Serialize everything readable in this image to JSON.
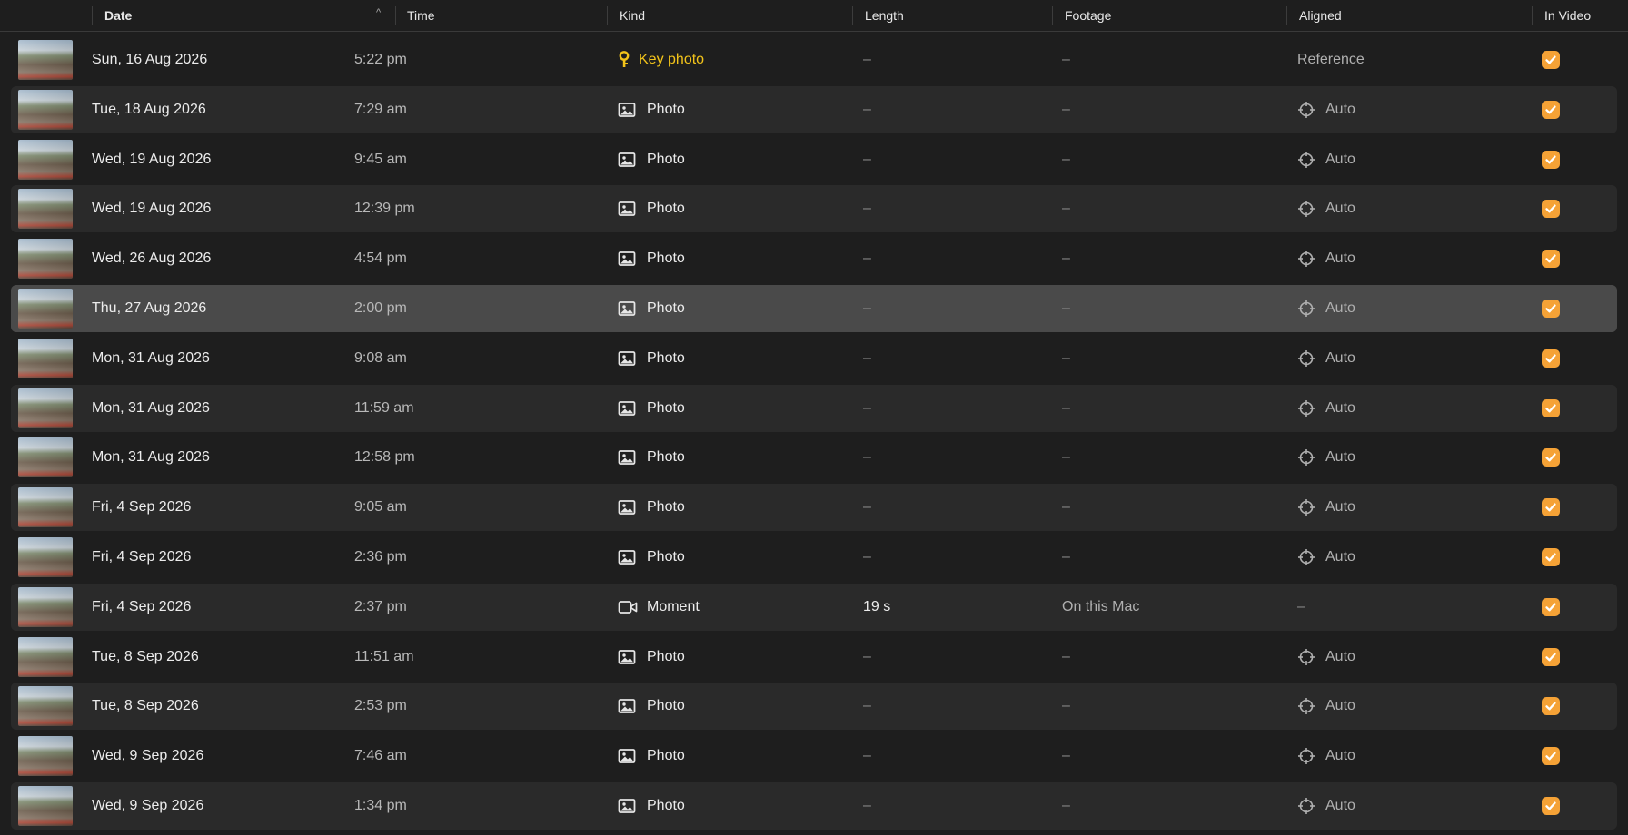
{
  "header": {
    "date": "Date",
    "time": "Time",
    "kind": "Kind",
    "length": "Length",
    "footage": "Footage",
    "aligned": "Aligned",
    "in_video": "In Video",
    "sort_indicator": "^"
  },
  "colors": {
    "accent": "#f5a236",
    "key_photo": "#f2c31a",
    "selected_row": "#4a4a4a",
    "alt_row": "#2a2a2a"
  },
  "rows": [
    {
      "date": "Sun, 16 Aug 2026",
      "time": "5:22 pm",
      "kind": "Key photo",
      "kind_icon": "key-icon",
      "length": "–",
      "footage": "–",
      "aligned": "Reference",
      "aligned_icon": "",
      "in_video": true
    },
    {
      "date": "Tue, 18 Aug 2026",
      "time": "7:29 am",
      "kind": "Photo",
      "kind_icon": "photo-icon",
      "length": "–",
      "footage": "–",
      "aligned": "Auto",
      "aligned_icon": "crosshair-icon",
      "in_video": true
    },
    {
      "date": "Wed, 19 Aug 2026",
      "time": "9:45 am",
      "kind": "Photo",
      "kind_icon": "photo-icon",
      "length": "–",
      "footage": "–",
      "aligned": "Auto",
      "aligned_icon": "crosshair-icon",
      "in_video": true
    },
    {
      "date": "Wed, 19 Aug 2026",
      "time": "12:39 pm",
      "kind": "Photo",
      "kind_icon": "photo-icon",
      "length": "–",
      "footage": "–",
      "aligned": "Auto",
      "aligned_icon": "crosshair-icon",
      "in_video": true
    },
    {
      "date": "Wed, 26 Aug 2026",
      "time": "4:54 pm",
      "kind": "Photo",
      "kind_icon": "photo-icon",
      "length": "–",
      "footage": "–",
      "aligned": "Auto",
      "aligned_icon": "crosshair-icon",
      "in_video": true
    },
    {
      "date": "Thu, 27 Aug 2026",
      "time": "2:00 pm",
      "kind": "Photo",
      "kind_icon": "photo-icon",
      "length": "–",
      "footage": "–",
      "aligned": "Auto",
      "aligned_icon": "crosshair-icon",
      "in_video": true,
      "selected": true
    },
    {
      "date": "Mon, 31 Aug 2026",
      "time": "9:08 am",
      "kind": "Photo",
      "kind_icon": "photo-icon",
      "length": "–",
      "footage": "–",
      "aligned": "Auto",
      "aligned_icon": "crosshair-icon",
      "in_video": true
    },
    {
      "date": "Mon, 31 Aug 2026",
      "time": "11:59 am",
      "kind": "Photo",
      "kind_icon": "photo-icon",
      "length": "–",
      "footage": "–",
      "aligned": "Auto",
      "aligned_icon": "crosshair-icon",
      "in_video": true
    },
    {
      "date": "Mon, 31 Aug 2026",
      "time": "12:58 pm",
      "kind": "Photo",
      "kind_icon": "photo-icon",
      "length": "–",
      "footage": "–",
      "aligned": "Auto",
      "aligned_icon": "crosshair-icon",
      "in_video": true
    },
    {
      "date": "Fri, 4 Sep 2026",
      "time": "9:05 am",
      "kind": "Photo",
      "kind_icon": "photo-icon",
      "length": "–",
      "footage": "–",
      "aligned": "Auto",
      "aligned_icon": "crosshair-icon",
      "in_video": true
    },
    {
      "date": "Fri, 4 Sep 2026",
      "time": "2:36 pm",
      "kind": "Photo",
      "kind_icon": "photo-icon",
      "length": "–",
      "footage": "–",
      "aligned": "Auto",
      "aligned_icon": "crosshair-icon",
      "in_video": true
    },
    {
      "date": "Fri, 4 Sep 2026",
      "time": "2:37 pm",
      "kind": "Moment",
      "kind_icon": "video-icon",
      "length": "19 s",
      "footage": "On this Mac",
      "aligned": "–",
      "aligned_icon": "",
      "in_video": true
    },
    {
      "date": "Tue, 8 Sep 2026",
      "time": "11:51 am",
      "kind": "Photo",
      "kind_icon": "photo-icon",
      "length": "–",
      "footage": "–",
      "aligned": "Auto",
      "aligned_icon": "crosshair-icon",
      "in_video": true
    },
    {
      "date": "Tue, 8 Sep 2026",
      "time": "2:53 pm",
      "kind": "Photo",
      "kind_icon": "photo-icon",
      "length": "–",
      "footage": "–",
      "aligned": "Auto",
      "aligned_icon": "crosshair-icon",
      "in_video": true
    },
    {
      "date": "Wed, 9 Sep 2026",
      "time": "7:46 am",
      "kind": "Photo",
      "kind_icon": "photo-icon",
      "length": "–",
      "footage": "–",
      "aligned": "Auto",
      "aligned_icon": "crosshair-icon",
      "in_video": true
    },
    {
      "date": "Wed, 9 Sep 2026",
      "time": "1:34 pm",
      "kind": "Photo",
      "kind_icon": "photo-icon",
      "length": "–",
      "footage": "–",
      "aligned": "Auto",
      "aligned_icon": "crosshair-icon",
      "in_video": true
    }
  ]
}
